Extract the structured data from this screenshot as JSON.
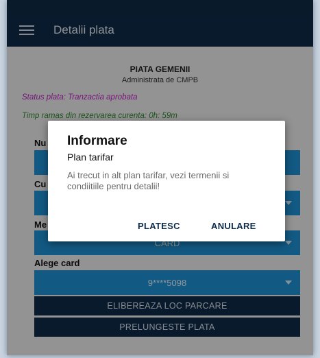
{
  "appbar": {
    "title": "Detalii plata",
    "menu_icon": "hamburger-menu-icon"
  },
  "info": {
    "market_name": "PIATA GEMENII",
    "administrator": "Administrata de CMPB",
    "status": "Status plata: Tranzactia aprobata",
    "time_remaining": "Timp ramas din rezervarea curenta: 0h: 59m"
  },
  "form": {
    "label_1": "Nu",
    "label_2": "Cu",
    "label_3": "Me",
    "field_3_value": "CARD",
    "card_label": "Alege card",
    "card_value": "9****5098"
  },
  "buttons": {
    "release": "ELIBEREAZA LOC PARCARE",
    "extend": "PRELUNGESTE PLATA"
  },
  "dialog": {
    "title": "Informare",
    "subtitle": "Plan tarifar",
    "message": "Ai trecut in alt plan tarifar, vezi termenii si condiitiile pentru detalii!",
    "confirm": "PLATESC",
    "cancel": "ANULARE"
  },
  "colors": {
    "appbar": "#0f2b48",
    "field_blue": "#1d90d4",
    "status_magenta": "#c020c6",
    "timer_green": "#2e8a2e"
  }
}
